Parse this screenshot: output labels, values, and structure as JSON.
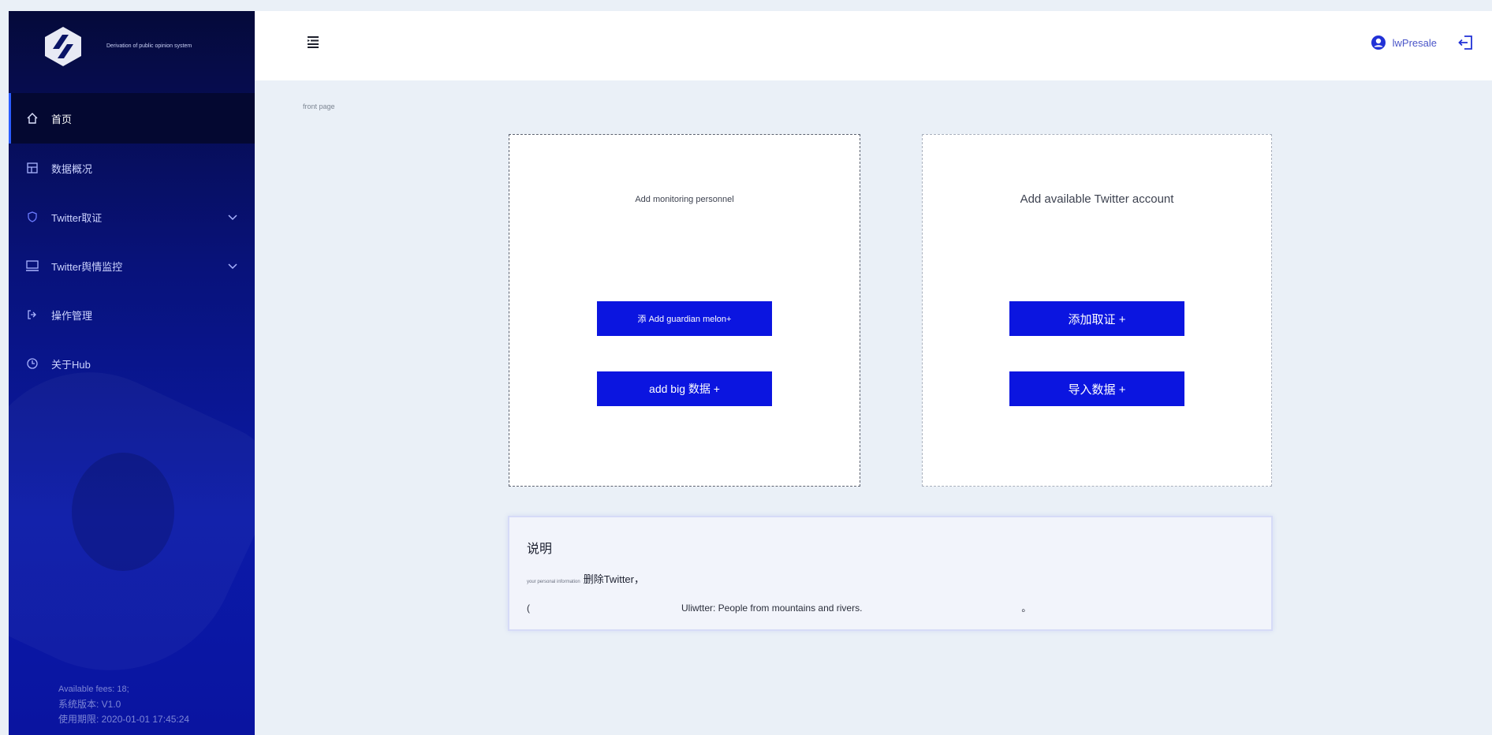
{
  "brand": {
    "title": "Derivation of public opinion system",
    "subtitle": ""
  },
  "sidebar": {
    "items": [
      {
        "label": "首页",
        "icon": "home-icon"
      },
      {
        "label": "数据概况",
        "icon": "grid-icon"
      },
      {
        "label": "Twitter取证",
        "icon": "shield-icon"
      },
      {
        "label": "Twitter舆情监控",
        "icon": "monitor-icon"
      },
      {
        "label": "操作管理",
        "icon": "log-icon"
      },
      {
        "label": "关于Hub",
        "icon": "clock-icon"
      }
    ],
    "footer": {
      "fees": "Available fees: 18;",
      "version": "系统版本: V1.0",
      "expiry": "使用期限: 2020-01-01 17:45:24"
    }
  },
  "header": {
    "username": "lwPresale"
  },
  "breadcrumb": "front page",
  "card_left": {
    "title": "Add monitoring personnel",
    "button1": "添 Add guardian melon+",
    "button2": "add big 数据 +"
  },
  "card_right": {
    "title": "Add available Twitter account",
    "button1": "添加取证 +",
    "button2": "导入数据 +"
  },
  "info": {
    "title": "说明",
    "line1_small": "your personal information",
    "line1": "删除Twitter，",
    "line2_lead": "(",
    "line2": "Uliwtter: People from mountains and rivers.",
    "line2_trail": "。"
  },
  "colors": {
    "primary": "#0b15e0",
    "sidebar_top": "#050a3a",
    "sidebar_bottom": "#0a14a0",
    "background": "#eaf0f7"
  }
}
